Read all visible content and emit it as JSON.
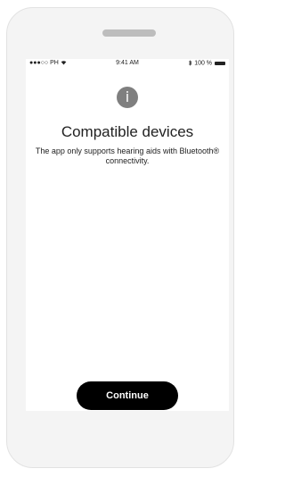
{
  "status_bar": {
    "carrier": "●●●○○ PH",
    "wifi_icon": "wifi-icon",
    "time": "9:41 AM",
    "bluetooth_icon": "bluetooth-icon",
    "battery": "100 %"
  },
  "dialog": {
    "icon": "info-icon",
    "icon_glyph": "i",
    "title": "Compatible devices",
    "description": "The app only supports hearing aids with Bluetooth® connectivity."
  },
  "actions": {
    "continue_label": "Continue"
  },
  "colors": {
    "button": "#000000",
    "icon": "#7f7f7f",
    "device": "#f4f4f4"
  }
}
